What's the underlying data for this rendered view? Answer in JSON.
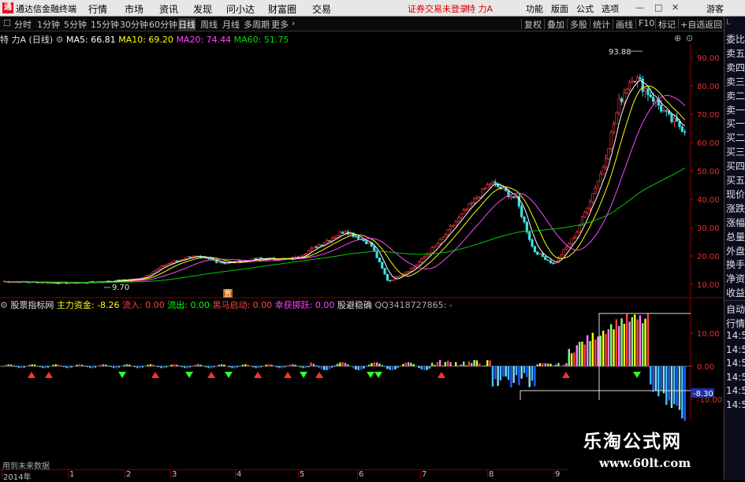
{
  "titlebar": {
    "logo_char": "通",
    "app_title": "通达信金融终端",
    "menus": [
      "行情",
      "市场",
      "资讯",
      "发现",
      "问小达",
      "财富圈",
      "交易"
    ],
    "warning": "证券交易未登录",
    "stock_title": "特 力A",
    "right_menus": [
      "功能",
      "版面",
      "公式",
      "选项"
    ],
    "guest": "游客"
  },
  "periods": [
    "分时",
    "1分钟",
    "5分钟",
    "15分钟",
    "30分钟",
    "60分钟",
    "日线",
    "周线",
    "月线",
    "多周期",
    "更多"
  ],
  "active_period": "日线",
  "tools": [
    "复权",
    "叠加",
    "多股",
    "统计",
    "画线",
    "F10",
    "标记",
    "+自选",
    "返回"
  ],
  "stock": {
    "name": "特 力A",
    "period_label": "(日线)"
  },
  "ma": [
    {
      "label": "MA5: 66.81",
      "color": "#ffffff"
    },
    {
      "label": "MA10: 69.20",
      "color": "#ffff00"
    },
    {
      "label": "MA20: 74.44",
      "color": "#ff44ff"
    },
    {
      "label": "MA60: 51.75",
      "color": "#00dd00"
    }
  ],
  "price_axis": [
    "90.00",
    "80.00",
    "70.00",
    "60.00",
    "50.00",
    "40.00",
    "30.00",
    "20.00",
    "10.00"
  ],
  "price_min_label": "9.70",
  "price_max_label": "93.88",
  "event_marker": "置",
  "right_panel_top": [
    "委比",
    "卖五",
    "卖四",
    "卖三",
    "卖二",
    "卖一",
    "买一",
    "买二",
    "买三",
    "买四",
    "买五",
    "现价",
    "涨跌",
    "涨幅",
    "总量",
    "外盘",
    "换手",
    "净资",
    "收益"
  ],
  "right_panel_bottom": [
    "自动",
    "行情",
    "14:5",
    "14:5",
    "14:5",
    "14:5",
    "14:5",
    "14:5"
  ],
  "indicator": {
    "name": "股票指标网",
    "main_label": "主力资金: -8.26",
    "inflow": "流入: 0.00",
    "outflow": "流出: 0.00",
    "dark_horse": "黑马启动: 0.00",
    "fast_jump": "幸获掷跃: 0.00",
    "avoid": "股避稳确",
    "qq": "QQ3418727865: -"
  },
  "ind_axis": [
    "10.00",
    "0.00",
    "-10.00"
  ],
  "ind_current": "-8.30",
  "footer_note": "用到未来数据",
  "time_axis": [
    "2014年",
    "1",
    "2",
    "3",
    "4",
    "5",
    "6",
    "7",
    "8",
    "9"
  ],
  "watermark": {
    "big": "乐淘公式网",
    "small": "www.60lt.com"
  }
}
